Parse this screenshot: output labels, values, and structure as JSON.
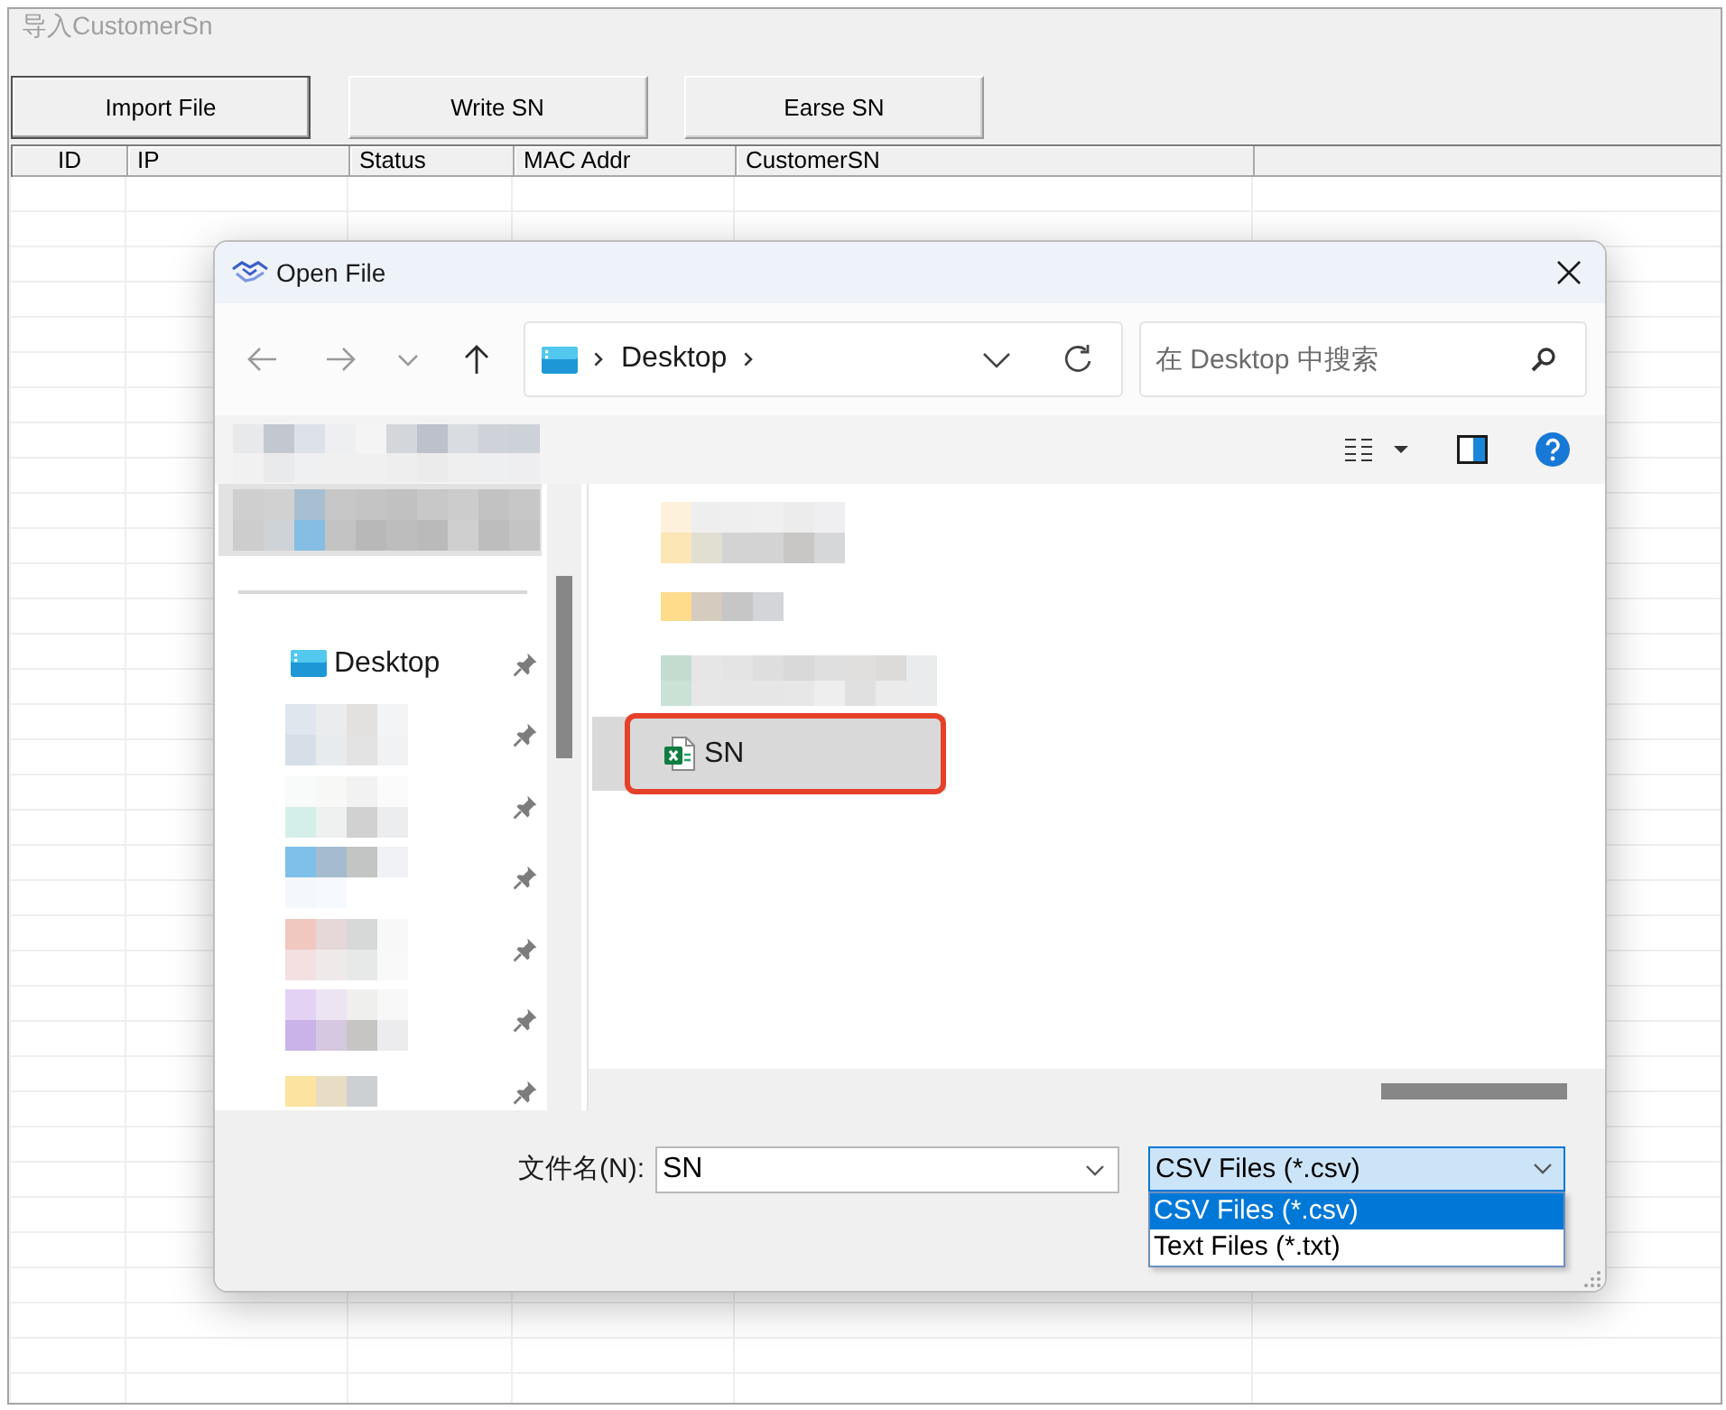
{
  "window": {
    "title": "导入CustomerSn"
  },
  "buttons": [
    {
      "label": "Import File",
      "focused": true
    },
    {
      "label": "Write SN",
      "focused": false
    },
    {
      "label": "Earse SN",
      "focused": false
    }
  ],
  "table": {
    "columns": [
      "ID",
      "IP",
      "Status",
      "MAC Addr",
      "CustomerSN"
    ]
  },
  "dialog": {
    "title": "Open File",
    "nav_buttons": [
      {
        "kind": "back",
        "disabled": true
      },
      {
        "kind": "forward",
        "disabled": true
      },
      {
        "kind": "recent",
        "disabled": true
      },
      {
        "kind": "up",
        "disabled": false
      }
    ],
    "address": {
      "path": [
        "Desktop"
      ]
    },
    "search": {
      "placeholder": "在 Desktop 中搜索"
    },
    "sidebar": {
      "sections": [
        {
          "items": [
            {
              "kind": "pixelated",
              "selected": true,
              "pinned": false
            }
          ]
        },
        {
          "items": [
            {
              "kind": "folder",
              "label": "Desktop",
              "selected": false,
              "pinned": true
            },
            {
              "kind": "pixelated",
              "selected": false,
              "pinned": true
            },
            {
              "kind": "pixelated",
              "selected": false,
              "pinned": true
            },
            {
              "kind": "pixelated",
              "selected": false,
              "pinned": true
            },
            {
              "kind": "pixelated",
              "selected": false,
              "pinned": true
            },
            {
              "kind": "pixelated",
              "selected": false,
              "pinned": true
            },
            {
              "kind": "pixelated",
              "selected": false,
              "pinned": true
            }
          ]
        }
      ]
    },
    "files": [
      {
        "kind": "pixelated",
        "selected": false,
        "highlighted": false
      },
      {
        "kind": "pixelated",
        "selected": false,
        "highlighted": false
      },
      {
        "kind": "pixelated",
        "selected": false,
        "highlighted": false
      },
      {
        "kind": "excel",
        "name": "SN",
        "selected": true,
        "highlighted": true
      }
    ],
    "filename": {
      "label": "文件名(N):",
      "value": "SN"
    },
    "filetype": {
      "value": "CSV Files (*.csv)",
      "expanded": true,
      "options": [
        {
          "label": "CSV Files (*.csv)",
          "selected": true
        },
        {
          "label": "Text Files (*.txt)",
          "selected": false
        }
      ]
    }
  }
}
